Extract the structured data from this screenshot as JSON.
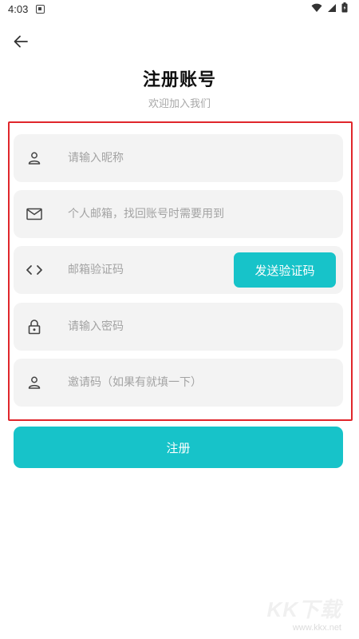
{
  "status_bar": {
    "time": "4:03",
    "icons": [
      "notification-icon",
      "wifi-icon",
      "signal-icon",
      "battery-icon"
    ]
  },
  "header": {
    "back_icon": "arrow-left-icon",
    "title": "注册账号",
    "subtitle": "欢迎加入我们"
  },
  "form": {
    "nickname": {
      "icon": "user-icon",
      "placeholder": "请输入昵称",
      "value": ""
    },
    "email": {
      "icon": "mail-icon",
      "placeholder": "个人邮箱，找回账号时需要用到",
      "value": ""
    },
    "email_code": {
      "icon": "code-icon",
      "placeholder": "邮箱验证码",
      "value": "",
      "send_label": "发送验证码"
    },
    "password": {
      "icon": "lock-icon",
      "placeholder": "请输入密码",
      "value": ""
    },
    "invite_code": {
      "icon": "user-icon",
      "placeholder": "邀请码（如果有就填一下）",
      "value": ""
    }
  },
  "register_label": "注册",
  "watermark": {
    "logo": "KK下载",
    "url": "www.kkx.net"
  },
  "colors": {
    "accent": "#17c3c9",
    "highlight_border": "#e0262b",
    "field_bg": "#f3f3f3",
    "placeholder": "#a3a3a3"
  }
}
